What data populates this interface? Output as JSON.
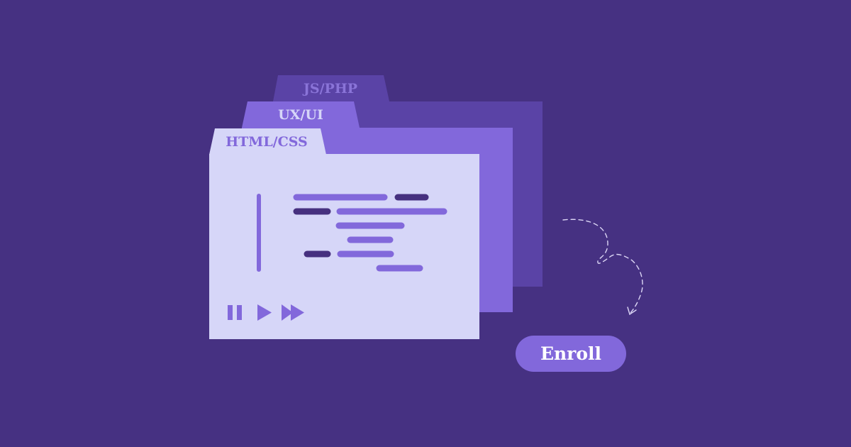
{
  "colors": {
    "background": "#463182",
    "folder_back": "#5a43a6",
    "folder_mid": "#8268db",
    "folder_front": "#d6d6f8",
    "tab_back": "#5a43a6",
    "tab_mid": "#8268db",
    "tab_front": "#d6d6f8",
    "label_back": "#8a74d8",
    "label_mid": "#d6d6f8",
    "label_front": "#8268db",
    "code_light": "#8268db",
    "code_dark": "#46307f",
    "button_fill": "#8268db",
    "button_text": "#ffffff",
    "arrow": "#dcd6f5"
  },
  "folders": {
    "back_tab": "JS/PHP",
    "mid_tab": "UX/UI",
    "front_tab": "HTML/CSS"
  },
  "media_controls": {
    "pause_icon": "pause-icon",
    "play_icon": "play-icon",
    "fast_forward_icon": "fast-forward-icon"
  },
  "cta": {
    "label": "Enroll"
  }
}
